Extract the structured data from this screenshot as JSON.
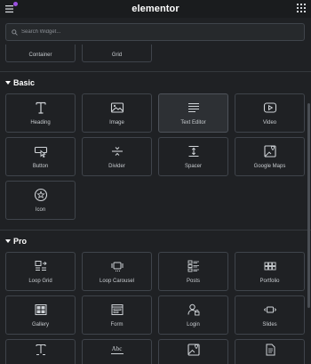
{
  "header": {
    "logo": "elementor",
    "menu_icon": "hamburger-icon",
    "grid_icon": "apps-grid-icon",
    "notification_color": "#9b51e0"
  },
  "search": {
    "placeholder": "Search Widget...",
    "value": ""
  },
  "layout_widgets": [
    {
      "label": "Container"
    },
    {
      "label": "Grid"
    }
  ],
  "sections": {
    "basic": {
      "title": "Basic",
      "widgets": [
        {
          "label": "Heading",
          "icon": "heading-icon"
        },
        {
          "label": "Image",
          "icon": "image-icon"
        },
        {
          "label": "Text Editor",
          "icon": "text-editor-icon"
        },
        {
          "label": "Video",
          "icon": "video-icon"
        },
        {
          "label": "Button",
          "icon": "button-icon"
        },
        {
          "label": "Divider",
          "icon": "divider-icon"
        },
        {
          "label": "Spacer",
          "icon": "spacer-icon"
        },
        {
          "label": "Google Maps",
          "icon": "google-maps-icon"
        },
        {
          "label": "Icon",
          "icon": "star-icon"
        }
      ]
    },
    "pro": {
      "title": "Pro",
      "widgets": [
        {
          "label": "Loop Grid",
          "icon": "loop-grid-icon"
        },
        {
          "label": "Loop Carousel",
          "icon": "loop-carousel-icon"
        },
        {
          "label": "Posts",
          "icon": "posts-icon"
        },
        {
          "label": "Portfolio",
          "icon": "portfolio-icon"
        },
        {
          "label": "Gallery",
          "icon": "gallery-icon"
        },
        {
          "label": "Form",
          "icon": "form-icon"
        },
        {
          "label": "Login",
          "icon": "login-icon"
        },
        {
          "label": "Slides",
          "icon": "slides-icon"
        }
      ]
    }
  },
  "partial_row_icons": [
    "heading-icon",
    "text-abc-icon",
    "image-icon",
    "document-icon"
  ],
  "partial_row_text": {
    "abc": "Abc"
  }
}
